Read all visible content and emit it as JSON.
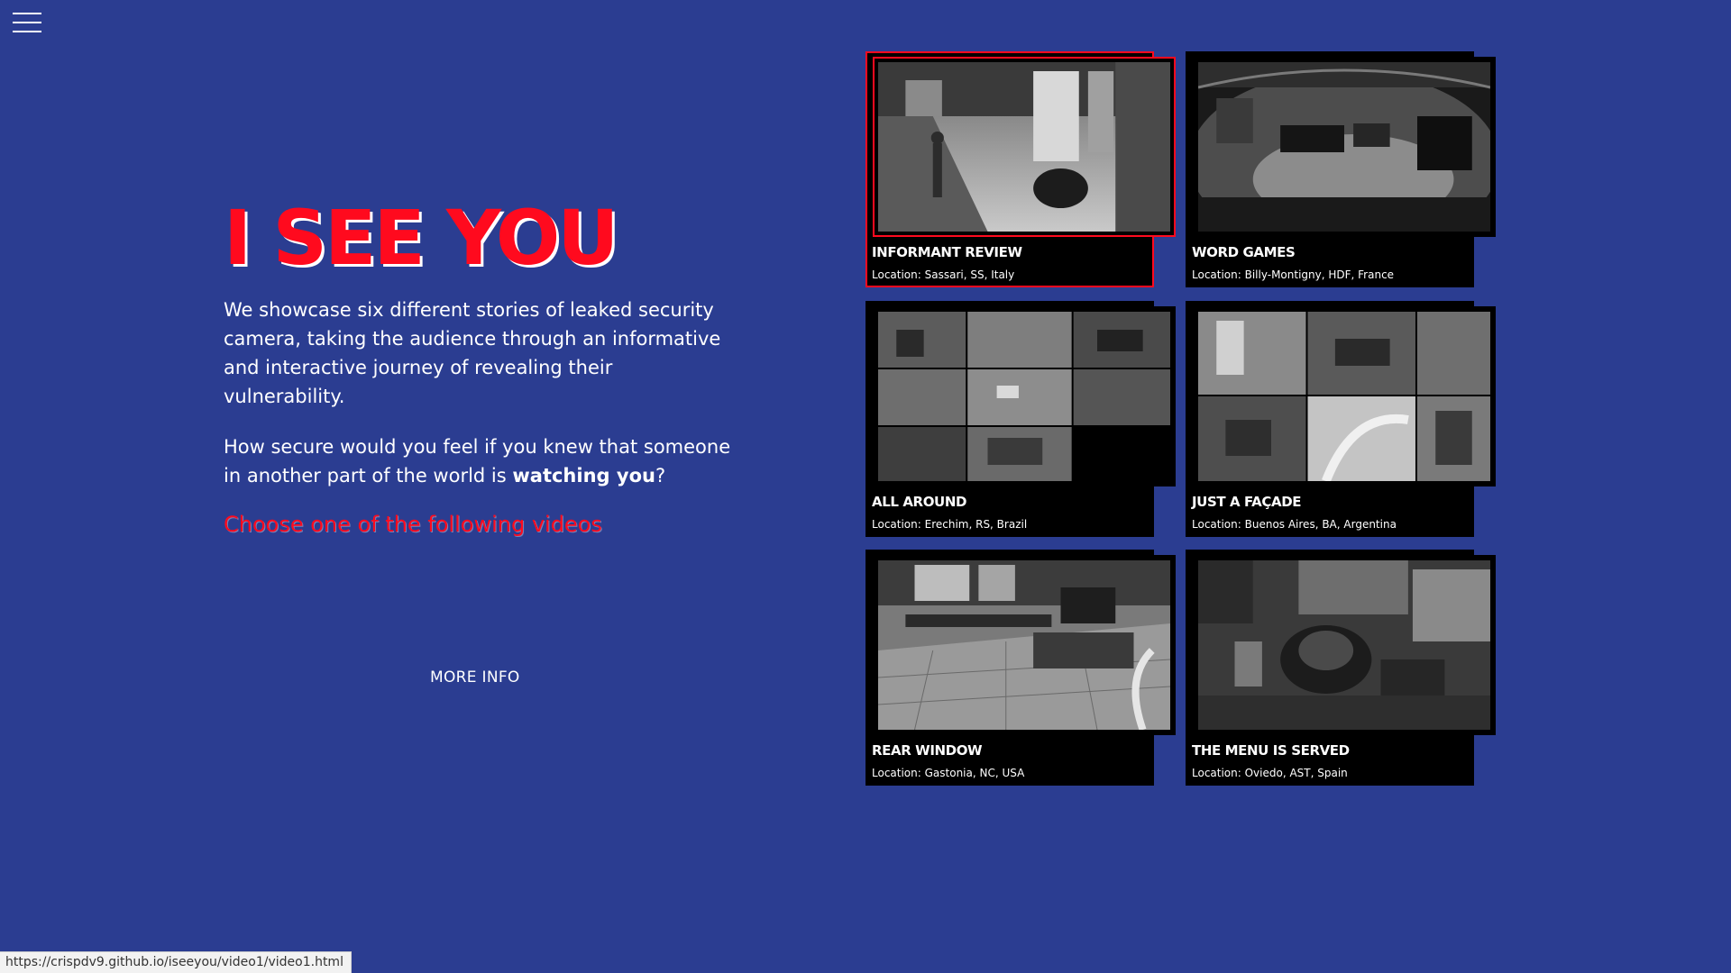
{
  "menu": {
    "icon": "hamburger-menu-icon"
  },
  "hero": {
    "title": "I SEE YOU",
    "description": "We showcase six different stories of leaked security camera, taking the audience through an informative and interactive journey of revealing their vulnerability.",
    "question_prefix": "How secure would you feel if you knew that someone in another part of the world is ",
    "question_emphasis": "watching you",
    "question_suffix": "?",
    "cta": "Choose one of the following videos",
    "more_info": "MORE INFO"
  },
  "colors": {
    "background": "#2b3d91",
    "accent": "#ff0a1e",
    "card": "#000000"
  },
  "videos": [
    {
      "title": "INFORMANT REVIEW",
      "location": "Location: Sassari, SS, Italy",
      "thumbnail": "cctv-cafe-counter",
      "active": true
    },
    {
      "title": "WORD GAMES",
      "location": "Location: Billy-Montigny, HDF, France",
      "thumbnail": "cctv-garage-fisheye",
      "active": false
    },
    {
      "title": "ALL AROUND",
      "location": "Location: Erechim, RS, Brazil",
      "thumbnail": "cctv-multi-view-grid",
      "active": false
    },
    {
      "title": "JUST A FAÇADE",
      "location": "Location: Buenos Aires, BA, Argentina",
      "thumbnail": "cctv-quad-view",
      "active": false
    },
    {
      "title": "REAR WINDOW",
      "location": "Location: Gastonia, NC, USA",
      "thumbnail": "cctv-restaurant-floor",
      "active": false
    },
    {
      "title": "THE MENU IS SERVED",
      "location": "Location: Oviedo, AST, Spain",
      "thumbnail": "cctv-desk-overhead",
      "active": false
    }
  ],
  "status_bar": {
    "url": "https://crispdv9.github.io/iseeyou/video1/video1.html"
  }
}
